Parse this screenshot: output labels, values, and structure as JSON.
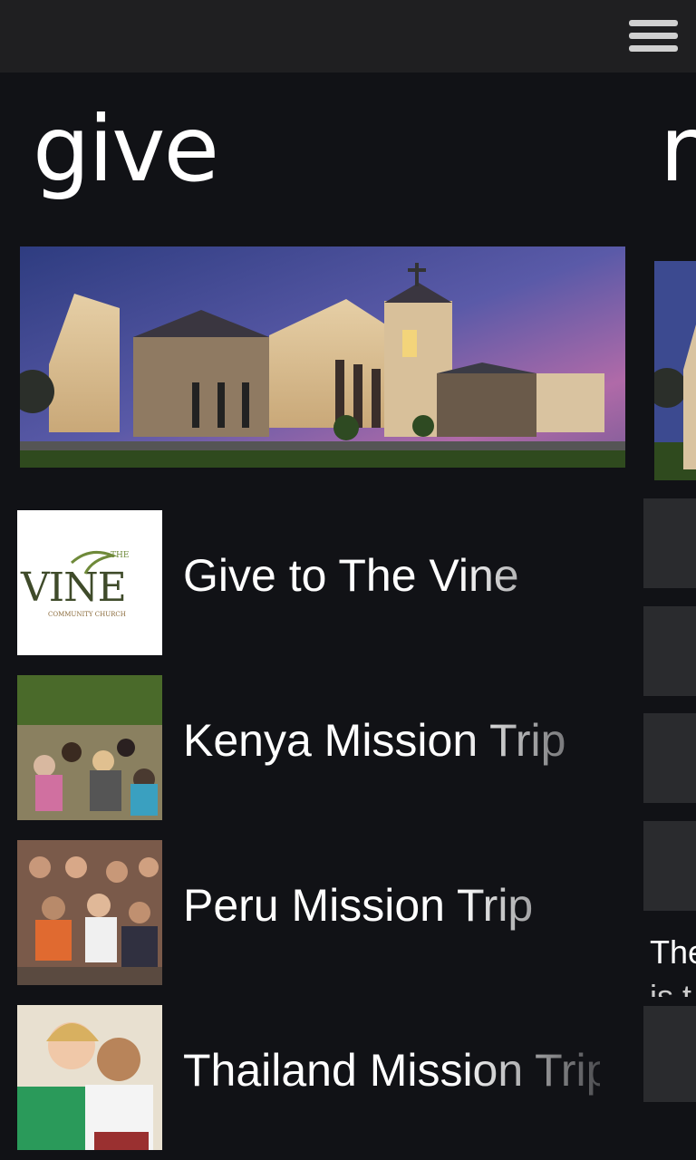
{
  "header": {
    "menu_icon": "hamburger-menu-icon"
  },
  "page": {
    "title": "give",
    "next_title_peek": "n"
  },
  "hero": {
    "alt": "church building at dusk"
  },
  "items": [
    {
      "label": "Give to The Vine",
      "thumb": "vine-logo"
    },
    {
      "label": "Kenya Mission Trip",
      "thumb": "kenya-photo"
    },
    {
      "label": "Peru Mission Trip",
      "thumb": "peru-photo"
    },
    {
      "label": "Thailand Mission Trip",
      "thumb": "thailand-photo"
    }
  ],
  "logo": {
    "the": "THE",
    "word": "VINE",
    "sub": "COMMUNITY CHURCH"
  },
  "peek": {
    "text_line1": "The",
    "text_line2": "is t"
  },
  "colors": {
    "background": "#111216",
    "topbar": "#1f1f21",
    "tile": "#2a2b2e"
  }
}
